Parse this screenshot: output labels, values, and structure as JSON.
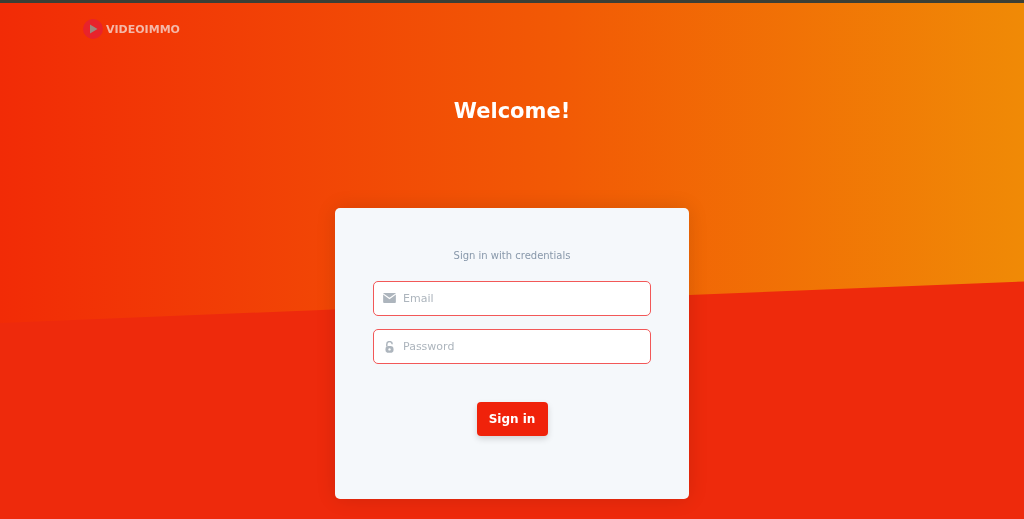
{
  "brand": {
    "name": "VIDEOIMMO"
  },
  "heading": "Welcome!",
  "login_card": {
    "subtitle": "Sign in with credentials",
    "fields": [
      {
        "kind": "email",
        "placeholder": "Email"
      },
      {
        "kind": "password",
        "placeholder": "Password"
      }
    ],
    "submit": "Sign in"
  }
}
